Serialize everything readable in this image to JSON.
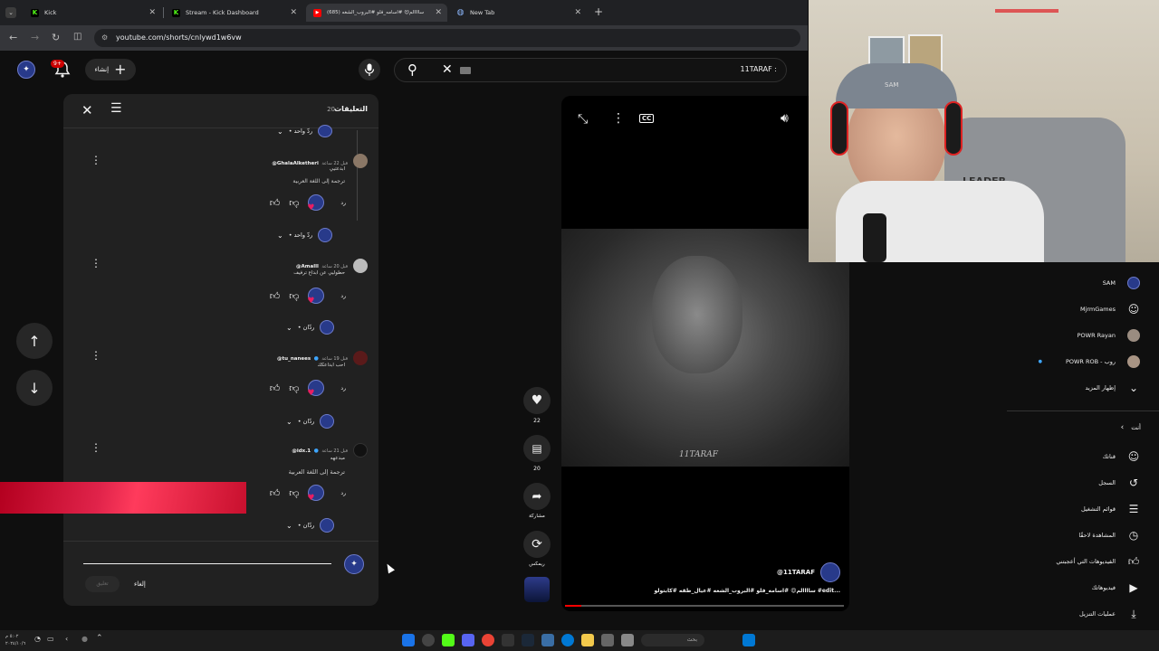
{
  "tabs": [
    {
      "label": "Kick",
      "icon": "kick-icon",
      "color": "#53fc18"
    },
    {
      "label": "Stream - Kick Dashboard",
      "icon": "kick-icon",
      "color": "#53fc18"
    },
    {
      "label": "(685) ساااالم😍 #اسامه_فلو #البروب_الشغه",
      "icon": "youtube-icon",
      "color": "#ff0000"
    },
    {
      "label": "New Tab",
      "icon": "globe-icon",
      "color": "#8ab4f8"
    }
  ],
  "address": {
    "url": "youtube.com/shorts/cnlywd1w6vw"
  },
  "header": {
    "create_label": "إنشاء",
    "notif_count": "9+",
    "search_value": "11TARAF :"
  },
  "comments": {
    "title": "التعليقات",
    "count": "20",
    "reply_word": "رد",
    "items": [
      {
        "user": "@GhalaAlketheri",
        "time": "قبل 22 ساعة",
        "text": "ابدعتيي",
        "translate": "ترجمة إلى اللغة العربية",
        "replies": "• ردّ واحد"
      },
      {
        "user": "@Amalll",
        "time": "قبل 20 ساعة",
        "text": "حطوليي عن ابداع ترفيف",
        "translate": "",
        "replies": "• ردّان"
      },
      {
        "user": "@tu_nanees",
        "time": "قبل 19 ساعة",
        "text": "احب ابداعكك",
        "translate": "",
        "replies": "• ردّان"
      },
      {
        "user": "@idx.1",
        "time": "قبل 21 ساعة",
        "text": "مبدعهه",
        "translate": "ترجمة إلى اللغة العربية",
        "replies": "• ردّان"
      }
    ],
    "top_replies": "• ردّ واحد",
    "cancel_label": "إلغاء",
    "submit_label": "تعليق"
  },
  "actions": {
    "likes": "22",
    "comments": "20",
    "share_label": "مشاركة",
    "remix_label": "ريمكس"
  },
  "video": {
    "watermark": "11TARAF",
    "channel": "@11TARAF",
    "caption": "ساااالم😍 #اسامه_فلو #البروب_الشغه #عيال_طقه #كابتولو #edit..."
  },
  "subscriptions": [
    {
      "name": "SAM",
      "icon": "avatar-blue"
    },
    {
      "name": "MjrmGames",
      "icon": "avatar-robot"
    },
    {
      "name": "POWR Rayan",
      "icon": "avatar-photo"
    },
    {
      "name": "POWR ROB - روب",
      "icon": "avatar-photo"
    }
  ],
  "show_more": "إظهار المزيد",
  "you_section": {
    "title": "أنت",
    "items": [
      {
        "label": "قناتك",
        "icon": "user-icon"
      },
      {
        "label": "السجل",
        "icon": "history-icon"
      },
      {
        "label": "قوائم التشغيل",
        "icon": "playlist-icon"
      },
      {
        "label": "المشاهدة لاحقًا",
        "icon": "clock-icon"
      },
      {
        "label": "الفيديوهات التي أعجبتني",
        "icon": "thumb-up-icon"
      },
      {
        "label": "فيديوهاتك",
        "icon": "play-icon"
      },
      {
        "label": "عمليات التنزيل",
        "icon": "download-icon"
      }
    ]
  },
  "webcam": {
    "cap_text": "SAM",
    "chair_text": "LEADER"
  },
  "taskbar": {
    "search_placeholder": "بحث",
    "time": "٥:٠٢ م",
    "date": "٢٠٢٤/١٠/٦"
  }
}
